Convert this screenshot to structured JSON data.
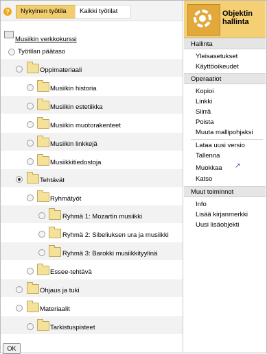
{
  "tabs": {
    "current": "Nykyinen työtila",
    "all": "Kaikki työtilat"
  },
  "tree": {
    "course_root": "Musiikin verkkokurssi",
    "workspace_root": "Työtilan päätaso",
    "items": {
      "oppimateriaali": "Oppimateriaali",
      "historia": "Musiikin historia",
      "estetiikka": "Musiikin estetiikka",
      "muotorakenteet": "Musiikin muotorakenteet",
      "linkkeja": "Musiikin linkkejä",
      "tiedostoja": "Musiikkitiedostoja",
      "tehtavat": "Tehtävät",
      "ryhmatyot": "Ryhmätyöt",
      "ryhma1": "Ryhmä 1: Mozartin musiikki",
      "ryhma2": "Ryhmä 2: Sibeliuksen ura ja musiikki",
      "ryhma3": "Ryhmä 3: Barokki musiikkityylinä",
      "essee": "Essee-tehtävä",
      "ohjaus": "Ohjaus ja tuki",
      "materiaalit": "Materiaalit",
      "tarkistuspisteet": "Tarkistuspisteet"
    },
    "selected": "Tehtävät"
  },
  "ok_label": "OK",
  "panel": {
    "title": "Objektin hallinta",
    "sections": {
      "hallinta": {
        "label": "Hallinta",
        "items": [
          "Yleisasetukset",
          "Käyttöoikeudet"
        ]
      },
      "operaatiot": {
        "label": "Operaatiot",
        "group1": [
          "Kopioi",
          "Linkki",
          "Siirrä",
          "Poista",
          "Muuta mallipohjaksi"
        ],
        "group2": [
          "Lataa uusi versio",
          "Tallenna",
          "Muokkaa",
          "Katso"
        ]
      },
      "muut": {
        "label": "Muut toiminnot",
        "items": [
          "Info",
          "Lisää kirjanmerkki",
          "Uusi lisäobjekti"
        ]
      }
    }
  },
  "icons": [
    "help-icon",
    "document-icon",
    "folder-icon",
    "gear-icon",
    "external-edit-icon"
  ],
  "colors": {
    "active_tab": "#f2cd6d",
    "panel_header": "#f5cf74",
    "section_header": "#e5e5e5",
    "row_alt": "#f2f2f2"
  }
}
